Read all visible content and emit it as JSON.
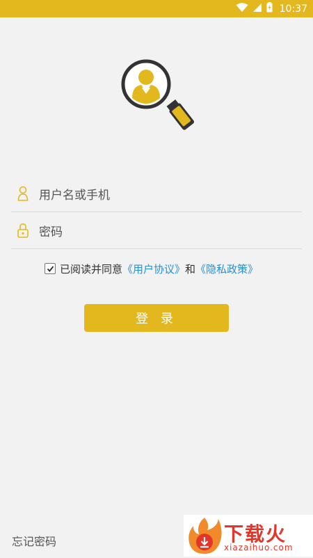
{
  "status_bar": {
    "time": "10:37",
    "battery_level": 0.9
  },
  "form": {
    "username_placeholder": "用户名或手机",
    "password_placeholder": "密码",
    "agreement": {
      "checked": true,
      "prefix": "已阅读并同意",
      "user_agreement": "《用户协议》",
      "and": "和",
      "privacy_policy": "《隐私政策》"
    },
    "login_button": "登 录",
    "forgot_password": "忘记密码"
  },
  "watermark": {
    "brand": "下载火",
    "url": "xiazaihuo.com"
  },
  "colors": {
    "accent": "#e3b81f",
    "link": "#2a8fd1",
    "watermark": "#e2362a"
  }
}
